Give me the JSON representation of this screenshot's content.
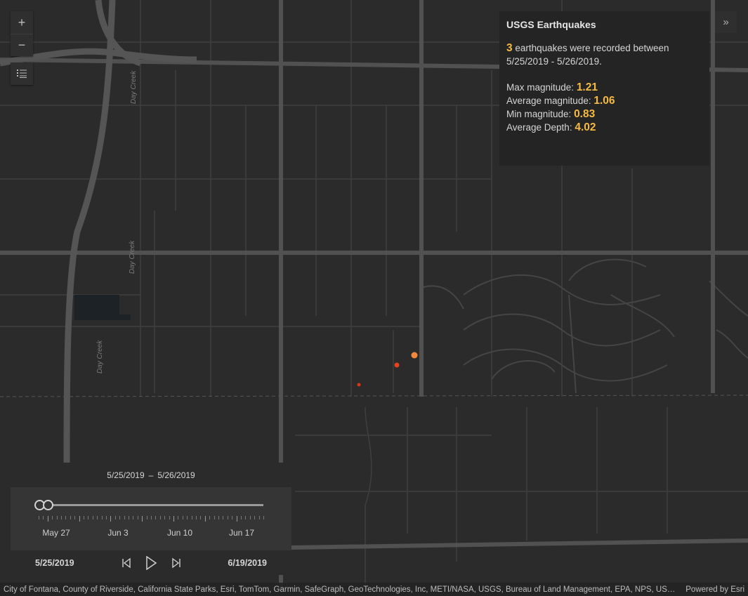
{
  "map": {
    "road_labels": [
      "Day Creek",
      "Day Creek",
      "Day Creek"
    ],
    "colors": {
      "background": "#2b2b2b",
      "road": "#4a4a4a",
      "major_road": "#505050",
      "quake_large": "#f0893e",
      "quake_small": "#e0451f"
    },
    "earthquakes": [
      {
        "magnitude": 1.21
      },
      {
        "magnitude": 1.06
      },
      {
        "magnitude": 0.83
      }
    ]
  },
  "controls": {
    "zoom_in_icon": "+",
    "zoom_out_icon": "−",
    "layer_list_icon": "list-icon",
    "collapse_icon": "»"
  },
  "info_panel": {
    "title": "USGS Earthquakes",
    "count": "3",
    "count_text": " earthquakes were recorded between",
    "date_range": "5/25/2019 - 5/26/2019.",
    "max_label": "Max magnitude: ",
    "max_value": "1.21",
    "avg_label": "Average magnitude: ",
    "avg_value": "1.06",
    "min_label": "Min magnitude: ",
    "min_value": "0.83",
    "depth_label": "Average Depth: ",
    "depth_value": "4.02"
  },
  "time_slider": {
    "range_start": "5/25/2019",
    "range_sep": "–",
    "range_end": "5/26/2019",
    "tick_labels": [
      "May 27",
      "Jun 3",
      "Jun 10",
      "Jun 17"
    ],
    "full_start": "5/25/2019",
    "full_end": "6/19/2019",
    "position_fraction": 0.0
  },
  "attribution": {
    "text": "City of Fontana, County of Riverside, California State Parks, Esri, TomTom, Garmin, SafeGraph, GeoTechnologies, Inc, METI/NASA, USGS, Bureau of Land Management, EPA, NPS, US Census Bureau, USDA",
    "powered_by": "Powered by Esri"
  }
}
